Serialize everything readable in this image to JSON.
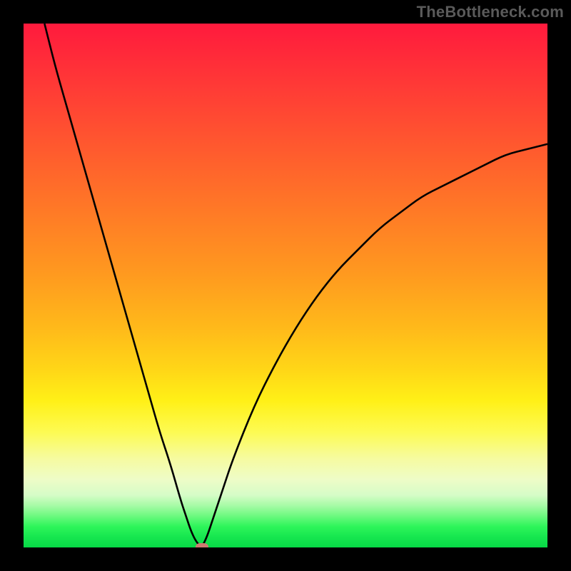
{
  "watermark": "TheBottleneck.com",
  "chart_data": {
    "type": "line",
    "title": "",
    "xlabel": "",
    "ylabel": "",
    "x_range": [
      0,
      100
    ],
    "y_range": [
      0,
      100
    ],
    "x": [
      4,
      6,
      8,
      10,
      12,
      14,
      16,
      18,
      20,
      22,
      24,
      26,
      28,
      30,
      31,
      32,
      33,
      34,
      35,
      36,
      38,
      40,
      44,
      48,
      52,
      56,
      60,
      64,
      68,
      72,
      76,
      80,
      84,
      88,
      92,
      96,
      100
    ],
    "y": [
      100,
      92,
      85,
      78,
      71,
      64,
      57,
      50,
      43,
      36,
      29,
      22,
      16,
      9,
      6,
      3,
      1,
      0,
      2,
      5,
      11,
      17,
      27,
      35,
      42,
      48,
      53,
      57,
      61,
      64,
      67,
      69,
      71,
      73,
      75,
      76,
      77
    ],
    "marker": {
      "x": 34,
      "y": 0
    },
    "gradient_stops": [
      {
        "pos": 0,
        "color": "#ff1a3d"
      },
      {
        "pos": 25,
        "color": "#ff6a2a"
      },
      {
        "pos": 50,
        "color": "#ffba1a"
      },
      {
        "pos": 72,
        "color": "#fff017"
      },
      {
        "pos": 85,
        "color": "#f0fbb0"
      },
      {
        "pos": 100,
        "color": "#07d946"
      }
    ]
  }
}
